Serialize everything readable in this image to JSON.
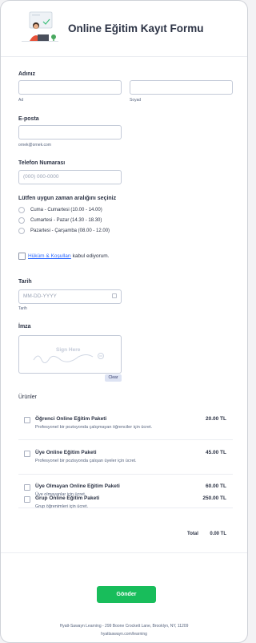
{
  "header": {
    "title": "Online Eğitim Kayıt Formu"
  },
  "name": {
    "label": "Adınız",
    "first_sub": "Ad",
    "last_sub": "Soyad"
  },
  "email": {
    "label": "E-posta",
    "hint": "ornek@ornek.com"
  },
  "phone": {
    "label": "Telefon Numarası",
    "placeholder": "(000) 000-0000"
  },
  "timeslot": {
    "label": "Lütfen uygun zaman aralığını seçiniz",
    "options": [
      "Cuma - Cumartesi (10.00 - 14.00)",
      "Cumartesi - Pazar (14.30 - 18.30)",
      "Pazartesi - Çarşamba (08.00 - 12.00)"
    ]
  },
  "terms": {
    "link": "Hüküm & Koşulları",
    "text": " kabul ediyorum."
  },
  "date": {
    "label": "Tarih",
    "placeholder": "MM-DD-YYYY",
    "sub": "Tarih"
  },
  "signature": {
    "label": "İmza",
    "placeholder": "Sign Here",
    "clear": "Clear"
  },
  "products": {
    "label": "Ürünler",
    "items": [
      {
        "name": "Öğrenci Online Eğitim Paketi",
        "desc": "Profesyonel bir pozisyonda çalışmayan öğrenciler için ücret.",
        "price": "20.00 TL"
      },
      {
        "name": "Üye Online Eğitim Paketi",
        "desc": "Profesyonel bir pozisyonda çalışan üyeler için ücret.",
        "price": "45.00 TL"
      },
      {
        "name": "Üye Olmayan Online Eğitim Paketi",
        "desc": "Üye olmayanlar için ücret.",
        "price": "60.00 TL"
      },
      {
        "name": "Grup Online Eğitim Paketi",
        "desc": "Grup öğrenimleri için ücret.",
        "price": "250.00 TL"
      }
    ],
    "total_label": "Total",
    "total_value": "0.00 TL"
  },
  "submit": {
    "label": "Gönder"
  },
  "footer": {
    "address": "Hyatt-Sawayn Learning - 299 Boone Crockett Lane, Brooklyn, NY, 11209",
    "url": "hyattsawayn.com/learning"
  },
  "colors": {
    "accent": "#18bd5b",
    "link": "#2e69ff",
    "text": "#2c3345"
  }
}
